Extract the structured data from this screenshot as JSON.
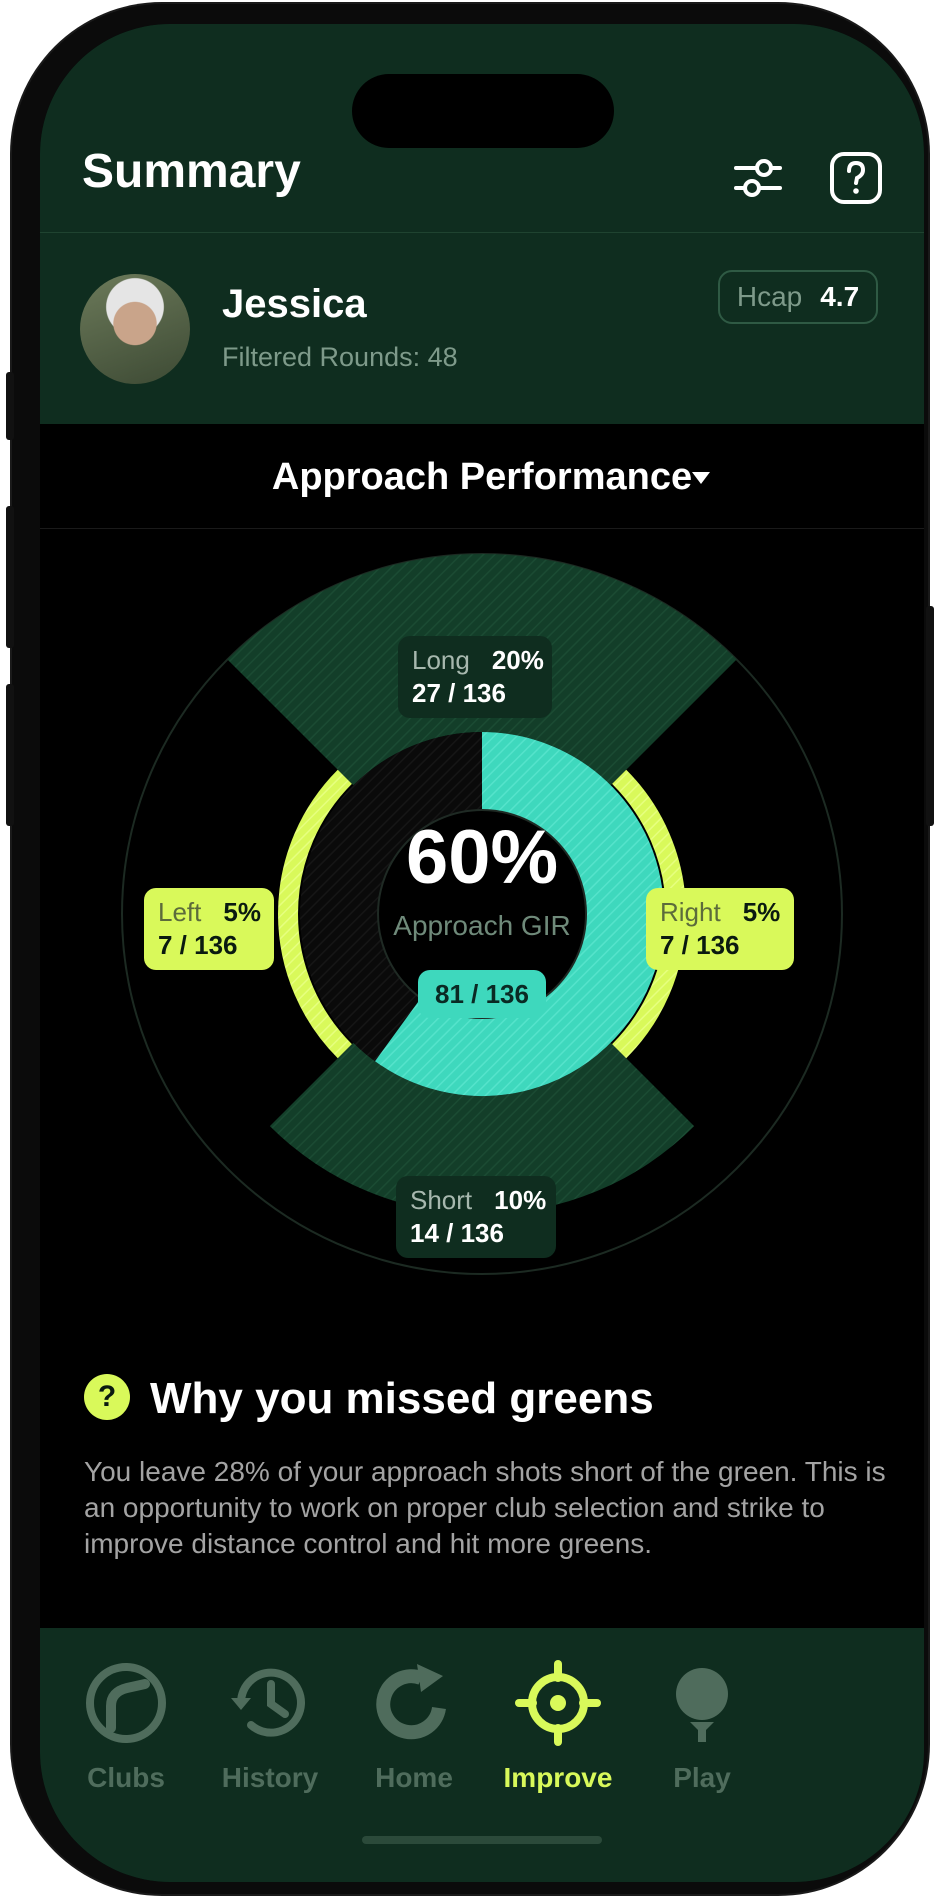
{
  "header": {
    "title": "Summary",
    "filter_icon": "sliders-icon",
    "help_icon": "question-square-icon"
  },
  "profile": {
    "name": "Jessica",
    "rounds": "Filtered Rounds: 48",
    "hcap_label": "Hcap",
    "hcap_value": "4.7"
  },
  "section": {
    "title": "Approach Performance"
  },
  "chart": {
    "center_value": "60%",
    "center_label": "Approach GIR",
    "center_count": "81 / 136",
    "long": {
      "label": "Long",
      "pct": "20%",
      "count": "27 / 136"
    },
    "left": {
      "label": "Left",
      "pct": "5%",
      "count": "7 / 136"
    },
    "right": {
      "label": "Right",
      "pct": "5%",
      "count": "7 / 136"
    },
    "short": {
      "label": "Short",
      "pct": "10%",
      "count": "14 / 136"
    },
    "colors": {
      "gir": "#3ed8bd",
      "side": "#d9f95a",
      "miss": "#133e29"
    }
  },
  "insight": {
    "icon": "question-circle-icon",
    "title": "Why you missed greens",
    "body": "You leave 28% of your approach shots short of the green. This is an opportunity to work on proper club selection and strike to improve distance control and hit more greens."
  },
  "tabs": [
    {
      "label": "Clubs",
      "icon": "club-icon"
    },
    {
      "label": "History",
      "icon": "history-icon"
    },
    {
      "label": "Home",
      "icon": "home-refresh-icon"
    },
    {
      "label": "Improve",
      "icon": "target-icon",
      "active": true
    },
    {
      "label": "Play",
      "icon": "golf-tee-icon"
    }
  ]
}
